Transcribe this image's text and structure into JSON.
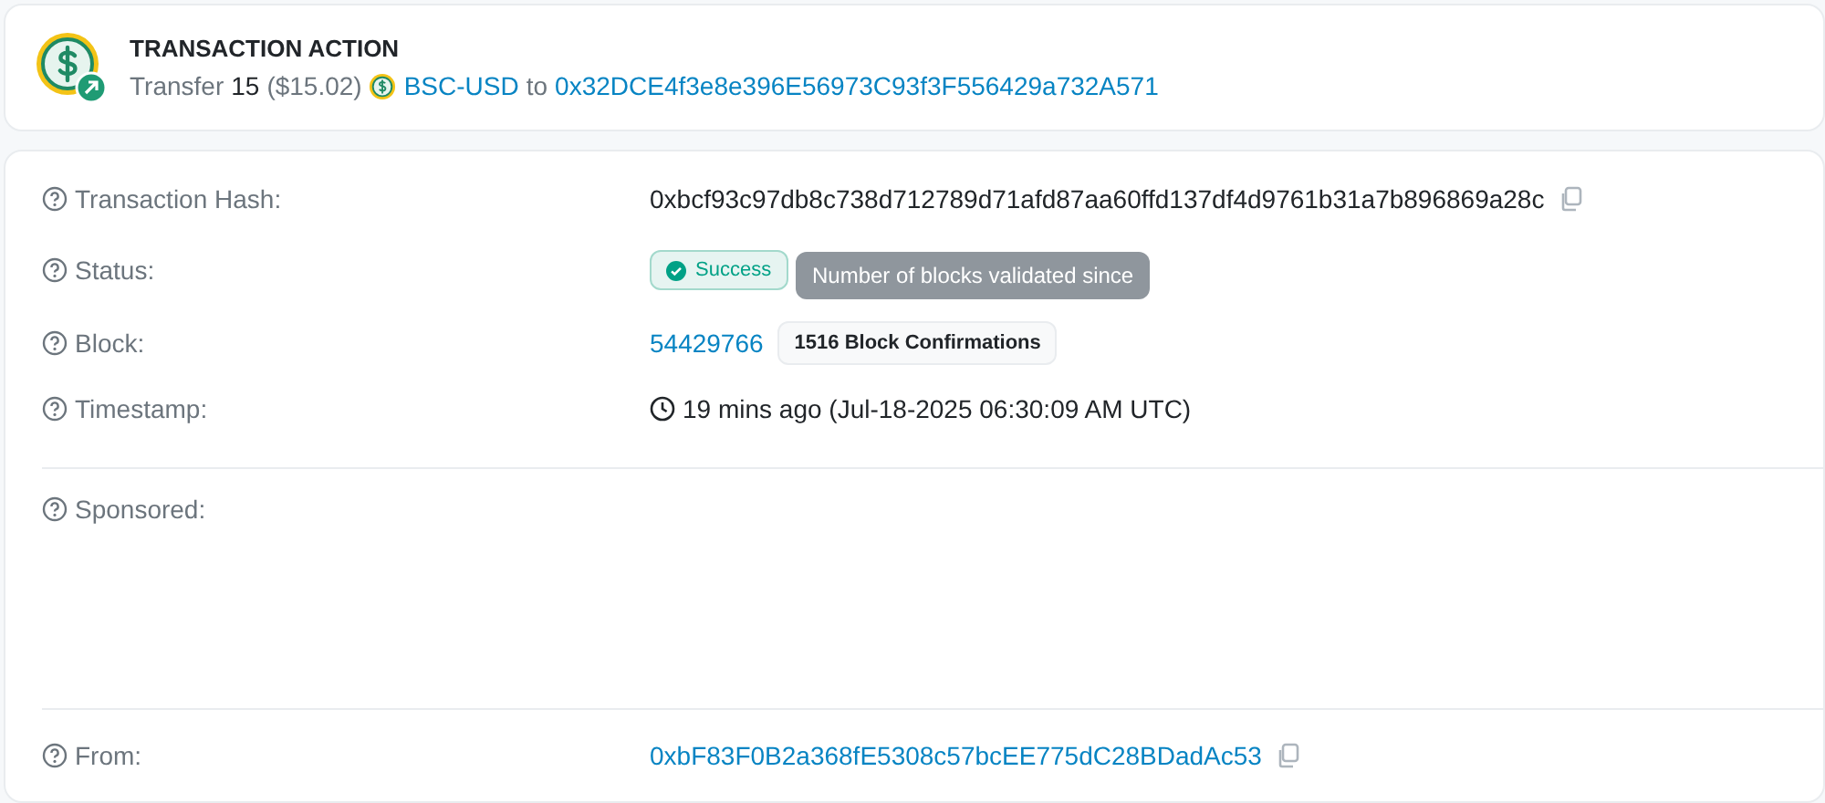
{
  "action": {
    "title": "TRANSACTION ACTION",
    "verb": "Transfer",
    "amount": "15",
    "usd": "($15.02)",
    "token": "BSC-USD",
    "to_word": "to",
    "to_address": "0x32DCE4f3e8e396E56973C93f3F556429a732A571"
  },
  "rows": [
    {
      "label": "Transaction Hash:",
      "kind": "hash",
      "value": "0xbcf93c97db8c738d712789d71afd87aa60ffd137df4d9761b31a7b896869a28c"
    },
    {
      "label": "Status:",
      "kind": "status",
      "value": "Success"
    },
    {
      "label": "Block:",
      "kind": "block",
      "value": "54429766",
      "badge": "1516 Block Confirmations",
      "tooltip": "Number of blocks validated since"
    },
    {
      "label": "Timestamp:",
      "kind": "time",
      "value": "19 mins ago (Jul-18-2025 06:30:09 AM UTC)"
    },
    {
      "label": "Sponsored:",
      "kind": "sponsored"
    },
    {
      "label": "From:",
      "kind": "address",
      "value": "0xbF83F0B2a368fE5308c57bcEE775dC28BDadAc53"
    }
  ]
}
